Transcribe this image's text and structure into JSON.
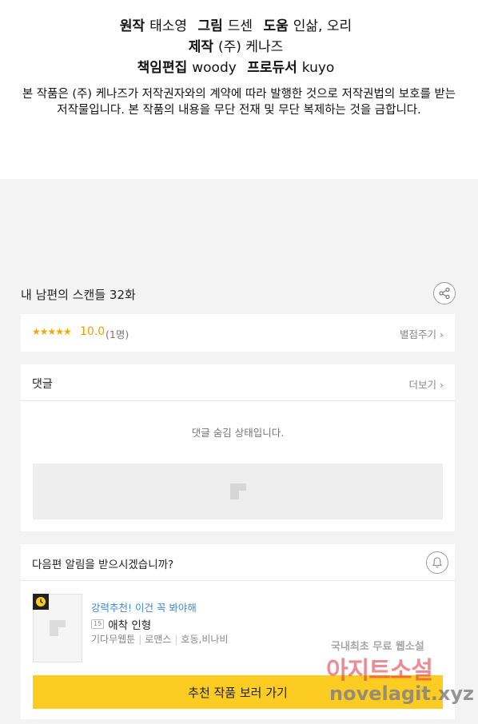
{
  "credits": {
    "line1": [
      {
        "label": "원작",
        "value": "태소영"
      },
      {
        "label": "그림",
        "value": "드센"
      },
      {
        "label": "도움",
        "value": "인삶, 오리"
      }
    ],
    "line2": {
      "label": "제작",
      "value": "(주) 케나즈"
    },
    "line3": [
      {
        "label": "책임편집",
        "value": "woody"
      },
      {
        "label": "프로듀서",
        "value": "kuyo"
      }
    ],
    "notice": "본 작품은 (주) 케나즈가 저작권자와의 계약에 따라 발행한 것으로 저작권법의 보호를 받는 저작물입니다. 본 작품의 내용을 무단 전재 및 무단 복제하는 것을 금합니다."
  },
  "episode": {
    "title": "내 남편의 스캔들 32화"
  },
  "rating": {
    "stars": "★★★★★",
    "value": "10.0",
    "count": "(1명)",
    "rate_link": "별점주기 ›"
  },
  "comments": {
    "title": "댓글",
    "more_link": "더보기 ›",
    "hidden_message": "댓글 숨김 상태입니다."
  },
  "notify": {
    "question": "다음편 알림을 받으시겠습니까?"
  },
  "recommendation": {
    "promo": "강력추천! 이건 꼭 봐야해",
    "age_badge": "15",
    "title": "애착 인형",
    "tags": [
      "기다무웹툰",
      "로맨스",
      "호동,비나비"
    ],
    "cta": "추천 작품 보러 가기"
  },
  "watermark": {
    "line1": "국내최초 무료 웹소설",
    "line2": "아지트소설",
    "line3": "novelagit.xyz"
  },
  "colors": {
    "accent_yellow": "#fccc22",
    "star_orange": "#f39c00",
    "promo_blue": "#3a8ad6",
    "background_gray": "#f3f3f3"
  }
}
